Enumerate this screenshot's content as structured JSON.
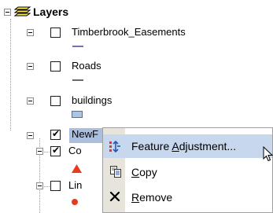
{
  "toc": {
    "root": {
      "label": "Layers"
    },
    "layers": [
      {
        "label": "Timberbrook_Easements",
        "checked": false,
        "symbol_color": "#7b6fb4"
      },
      {
        "label": "Roads",
        "checked": false,
        "symbol_color": "#6a6a6a"
      },
      {
        "label": "buildings",
        "checked": false,
        "symbol_color": "#a9c6ea"
      },
      {
        "label": "NewF",
        "checked": true
      },
      {
        "label": "Co",
        "checked": true,
        "symbol_color": "#e83a20"
      },
      {
        "label": "Lin",
        "checked": false,
        "symbol_color": "#e83a20"
      }
    ]
  },
  "context_menu": {
    "items": [
      {
        "label_pre": "Feature ",
        "label_ul": "A",
        "label_post": "djustment...",
        "icon": "feature-adjustment-icon"
      },
      {
        "label_pre": "",
        "label_ul": "C",
        "label_post": "opy",
        "icon": "copy-icon"
      },
      {
        "label_pre": "",
        "label_ul": "R",
        "label_post": "emove",
        "icon": "remove-icon"
      }
    ]
  },
  "colors": {
    "menu_highlight": "#c7d7ee",
    "selected_row": "#aabfe0",
    "menu_gutter": "#e7e4dc"
  }
}
